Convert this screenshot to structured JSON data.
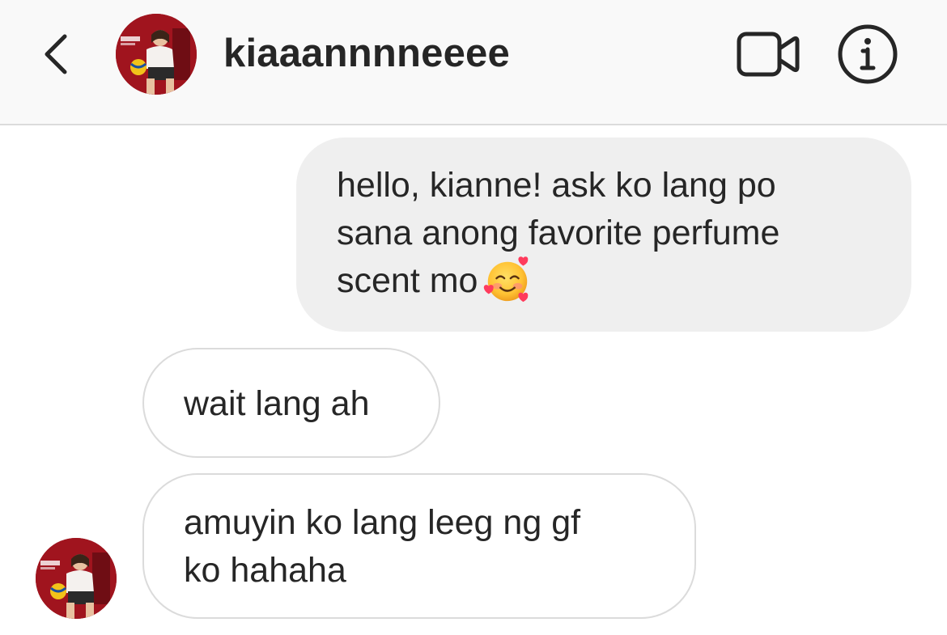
{
  "header": {
    "back_icon": "chevron-left-icon",
    "username": "kiaaannnneeee",
    "video_icon": "video-camera-icon",
    "info_icon": "info-icon"
  },
  "messages": [
    {
      "direction": "outgoing",
      "lines": [
        "hello, kianne! ask ko lang po",
        "sana anong favorite perfume",
        "scent mo"
      ],
      "emoji": "smiling-face-with-hearts"
    },
    {
      "direction": "incoming",
      "lines": [
        "wait lang ah"
      ]
    },
    {
      "direction": "incoming",
      "lines": [
        "amuyin ko lang leeg ng gf",
        "ko hahaha"
      ]
    }
  ],
  "colors": {
    "header_bg": "#f9f9f9",
    "divider": "#dbdbdb",
    "sent_bubble": "#efefef",
    "text": "#262626",
    "avatar_bg": "#9a1520"
  }
}
